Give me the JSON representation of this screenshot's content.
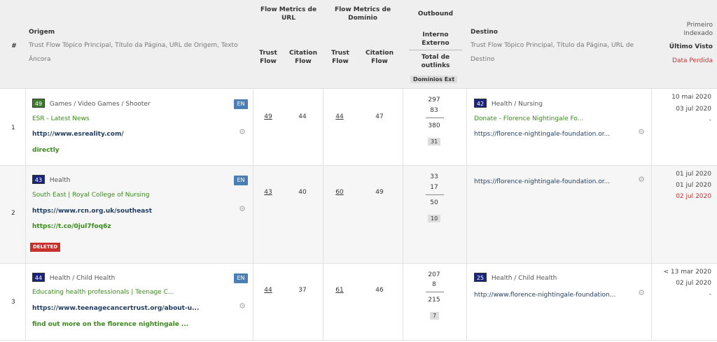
{
  "header": {
    "hash": "#",
    "origem": "Origem",
    "origem_sub": "Trust Flow Tópico Principal, Título da Página, URL de Origem, Texto Âncora",
    "flow_url": "Flow Metrics de URL",
    "flow_dominio": "Flow Metrics de Domínio",
    "trust_flow": "Trust Flow",
    "citation_flow": "Citation Flow",
    "outbound": "Outbound",
    "interno_externo": "Interno Externo",
    "total_outlinks": "Total de outlinks",
    "dominios_ext": "Domínios Ext",
    "destino": "Destino",
    "destino_sub": "Trust Flow Tópico Principal, Título da Página, URL de Destino",
    "primeiro_indexado": "Primeiro Indexado",
    "ultimo_visto": "Último Visto",
    "data_perdida": "Data Perdida"
  },
  "colors": {
    "en_badge": "#4a7fb5",
    "deleted": "#c9302c",
    "green_link": "#3a8a1c",
    "header_bg": "#efefef"
  },
  "rows": [
    {
      "index": "1",
      "source": {
        "tf": "49",
        "tf_color": "#3d7a2a",
        "category": "Games / Video Games / Shooter",
        "title": "ESR - Latest News",
        "url": "http://www.esreality.com/",
        "anchor": "directly",
        "lang": "EN"
      },
      "url_tf": "49",
      "url_cf": "44",
      "dom_tf": "44",
      "dom_cf": "47",
      "out_internal": "297",
      "out_external": "83",
      "out_total": "380",
      "out_domains": "31",
      "target": {
        "tf": "42",
        "tf_color": "#1a237e",
        "category": "Health / Nursing",
        "title": "Donate - Florence Nightingale Fo...",
        "url": "https://florence-nightingale-foundation.or..."
      },
      "first_indexed": "10 mai 2020",
      "last_seen": "03 jul 2020",
      "lost": "-"
    },
    {
      "index": "2",
      "source": {
        "tf": "43",
        "tf_color": "#1a237e",
        "category": "Health",
        "title": "South East | Royal College of Nursing",
        "url": "https://www.rcn.org.uk/southeast",
        "anchor": "https://t.co/0jul7foq6z",
        "lang": "EN",
        "deleted": "DELETED"
      },
      "url_tf": "43",
      "url_cf": "40",
      "dom_tf": "60",
      "dom_cf": "49",
      "out_internal": "33",
      "out_external": "17",
      "out_total": "50",
      "out_domains": "10",
      "target": {
        "url": "https://florence-nightingale-foundation.or..."
      },
      "first_indexed": "01 jul 2020",
      "last_seen": "01 jul 2020",
      "lost": "02 jul 2020"
    },
    {
      "index": "3",
      "source": {
        "tf": "44",
        "tf_color": "#1a237e",
        "category": "Health / Child Health",
        "title": "Educating health professionals | Teenage C...",
        "url": "https://www.teenagecancertrust.org/about-u...",
        "anchor": "find out more on the florence nightingale ...",
        "lang": "EN"
      },
      "url_tf": "44",
      "url_cf": "37",
      "dom_tf": "61",
      "dom_cf": "46",
      "out_internal": "207",
      "out_external": "8",
      "out_total": "215",
      "out_domains": "7",
      "target": {
        "tf": "25",
        "tf_color": "#1a237e",
        "category": "Health / Child Health",
        "url": "http://www.florence-nightingale-foundation..."
      },
      "first_indexed": "< 13 mar 2020",
      "last_seen": "02 jul 2020",
      "lost": "-"
    }
  ]
}
